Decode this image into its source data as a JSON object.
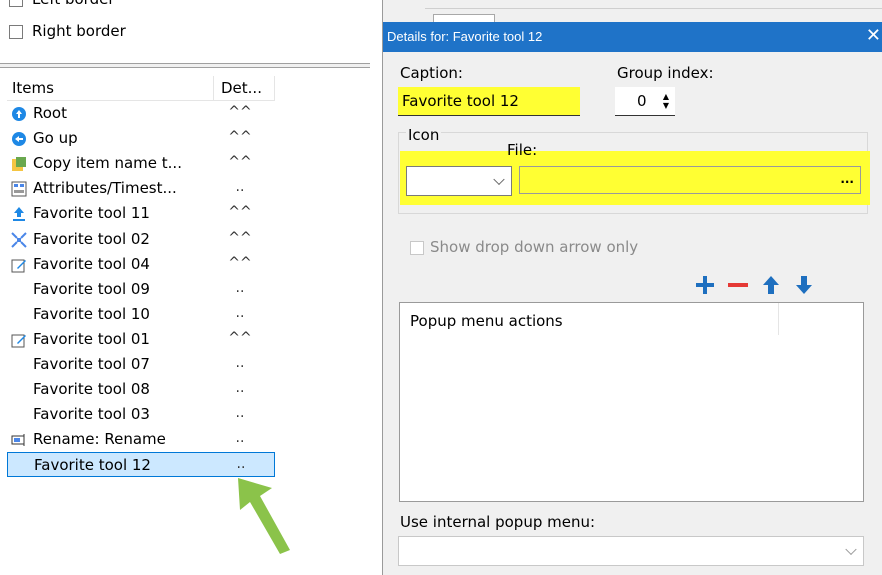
{
  "left": {
    "partial_label": "Left border",
    "right_border_label": "Right border",
    "columns": {
      "items": "Items",
      "details": "Det..."
    },
    "rows": [
      {
        "name": "Root",
        "det": "^^",
        "icon": "root-icon"
      },
      {
        "name": "Go up",
        "det": "^^",
        "icon": "go-up-icon"
      },
      {
        "name": "Copy item name t...",
        "det": "^^",
        "icon": "copy-icon"
      },
      {
        "name": "Attributes/Timest...",
        "det": "..",
        "icon": "attributes-icon"
      },
      {
        "name": "Favorite tool 11",
        "det": "^^",
        "icon": "upload-icon"
      },
      {
        "name": "Favorite tool 02",
        "det": "^^",
        "icon": "compress-icon"
      },
      {
        "name": "Favorite tool 04",
        "det": "^^",
        "icon": "edit-icon"
      },
      {
        "name": "Favorite tool 09",
        "det": "..",
        "icon": ""
      },
      {
        "name": "Favorite tool 10",
        "det": "..",
        "icon": ""
      },
      {
        "name": "Favorite tool 01",
        "det": "^^",
        "icon": "edit-icon"
      },
      {
        "name": "Favorite tool 07",
        "det": "..",
        "icon": ""
      },
      {
        "name": "Favorite tool 08",
        "det": "..",
        "icon": ""
      },
      {
        "name": "Favorite tool 03",
        "det": "..",
        "icon": ""
      },
      {
        "name": "Rename: Rename",
        "det": "..",
        "icon": "rename-icon"
      },
      {
        "name": "Favorite tool 12",
        "det": "..",
        "icon": "",
        "selected": true
      }
    ]
  },
  "panel": {
    "title": "Details for: Favorite tool 12",
    "close": "✕",
    "caption_label": "Caption:",
    "caption_value": "Favorite tool 12",
    "group_index_label": "Group index:",
    "group_index_value": "0",
    "icon_label": "Icon",
    "file_label": "File:",
    "file_button": "...",
    "show_dropdown_label": "Show drop down arrow only",
    "popup_header": "Popup menu actions",
    "use_internal_label": "Use internal popup menu:"
  },
  "colors": {
    "highlight": "#ffff33",
    "title_bar": "#1f73c8",
    "selection": "#cce8ff",
    "annotation_arrow": "#8bc34a",
    "add": "#1e6fbf",
    "remove": "#e53935"
  }
}
